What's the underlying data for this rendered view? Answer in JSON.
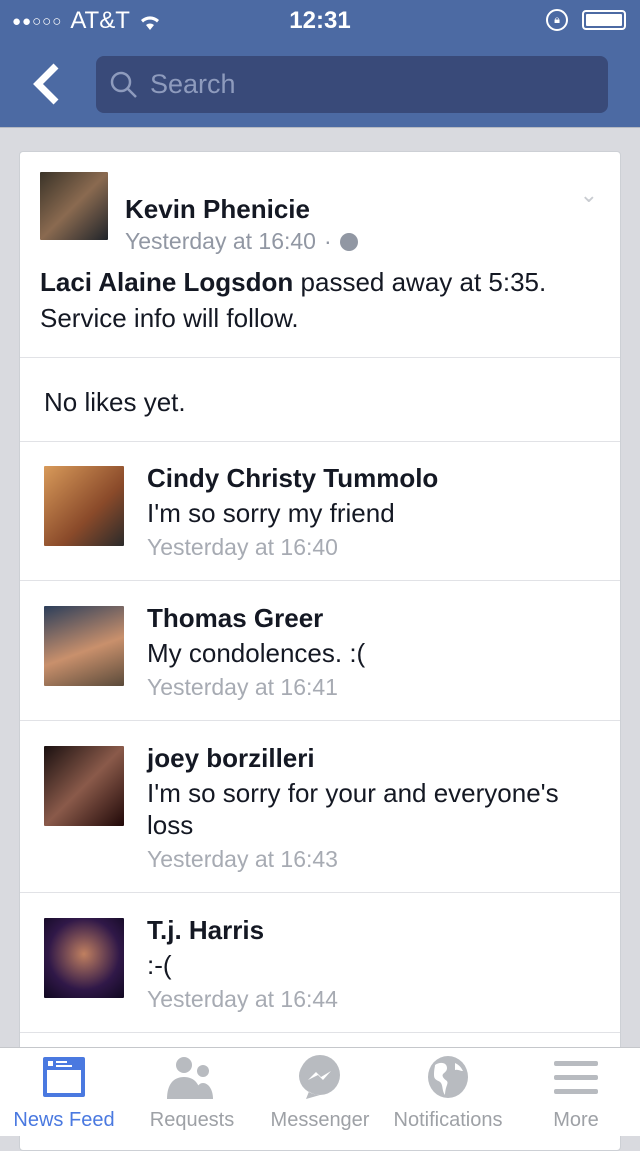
{
  "status": {
    "signal": "●●○○○",
    "carrier": "AT&T",
    "time": "12:31"
  },
  "nav": {
    "search_placeholder": "Search"
  },
  "post": {
    "author": "Kevin Phenicie",
    "time": "Yesterday at 16:40",
    "separator": "·",
    "text_bold": "Laci Alaine Logsdon",
    "text_rest": " passed away at 5:35. Service info will follow.",
    "likes": "No likes yet."
  },
  "comments": [
    {
      "name": "Cindy Christy Tummolo",
      "text": "I'm so sorry my friend",
      "time": "Yesterday at 16:40"
    },
    {
      "name": "Thomas Greer",
      "text": "My condolences. :(",
      "time": "Yesterday at 16:41"
    },
    {
      "name": "joey borzilleri",
      "text": "I'm so sorry for your and everyone's loss",
      "time": "Yesterday at 16:43"
    },
    {
      "name": "T.j. Harris",
      "text": ":-(",
      "time": "Yesterday at 16:44"
    }
  ],
  "tabs": [
    {
      "label": "News Feed"
    },
    {
      "label": "Requests"
    },
    {
      "label": "Messenger"
    },
    {
      "label": "Notifications"
    },
    {
      "label": "More"
    }
  ],
  "colors": {
    "brand": "#4c6aa3",
    "active_tab": "#4a79e0"
  }
}
